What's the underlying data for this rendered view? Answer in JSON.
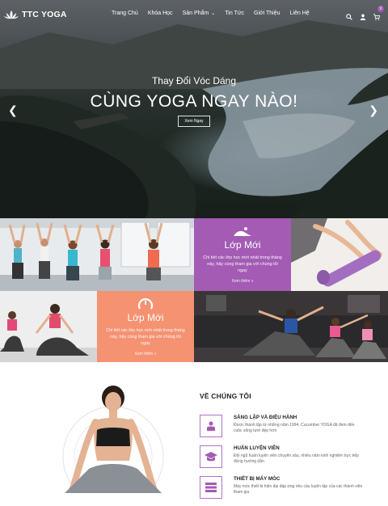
{
  "brand": {
    "name": "TTC YOGA"
  },
  "nav": {
    "items": [
      {
        "label": "Trang Chủ"
      },
      {
        "label": "Khóa Học"
      },
      {
        "label": "Sản Phẩm",
        "has_dropdown": true
      },
      {
        "label": "Tin Tức"
      },
      {
        "label": "Giới Thiệu"
      },
      {
        "label": "Liên Hệ"
      }
    ],
    "icons": [
      "search-icon",
      "user-icon",
      "cart-icon"
    ],
    "cart_count": "0"
  },
  "hero": {
    "subtitle": "Thay Đổi Vóc Dáng",
    "title": "CÙNG YOGA NGAY NÀO!",
    "button": "Xem Ngay",
    "prev_icon": "chevron-left-icon",
    "next_icon": "chevron-right-icon"
  },
  "promo_cards": [
    {
      "icon": "yoga-pose-icon",
      "title": "Lớp Mới",
      "description": "Chi tiết các lớp học mới nhất trong tháng này, hãy cùng tham gia với chúng tôi ngay",
      "link": "Xem thêm »",
      "color": "#a35bb4"
    },
    {
      "icon": "timer-icon",
      "title": "Lớp Mới",
      "description": "Chi tiết các lớp học mới nhất trong tháng này, hãy cùng tham gia với chúng tôi ngay",
      "link": "Xem thêm »",
      "color": "#f59272"
    }
  ],
  "about": {
    "title": "VỀ CHÚNG TÔI",
    "features": [
      {
        "icon": "founder-icon",
        "title": "SÁNG LẬP VÀ ĐIỀU HÀNH",
        "description": "Được thành lập từ những năm 1994, Cucumber YOGA đã đem đến cuộc sống tươi đẹp hơn"
      },
      {
        "icon": "graduation-cap-icon",
        "title": "HUẤN LUYỆN VIÊN",
        "description": "Đội ngũ huấn luyện viên chuyên sâu, nhiều năm kinh nghiệm trực tiếp đứng hướng dẫn"
      },
      {
        "icon": "equipment-icon",
        "title": "THIẾT BỊ MÁY MÓC",
        "description": "Máy móc thiết bị hiện đại đáp ứng nhu cầu luyện tập của các thành viên tham gia"
      }
    ]
  },
  "colors": {
    "accent": "#a35bb4",
    "orange": "#f59272"
  }
}
